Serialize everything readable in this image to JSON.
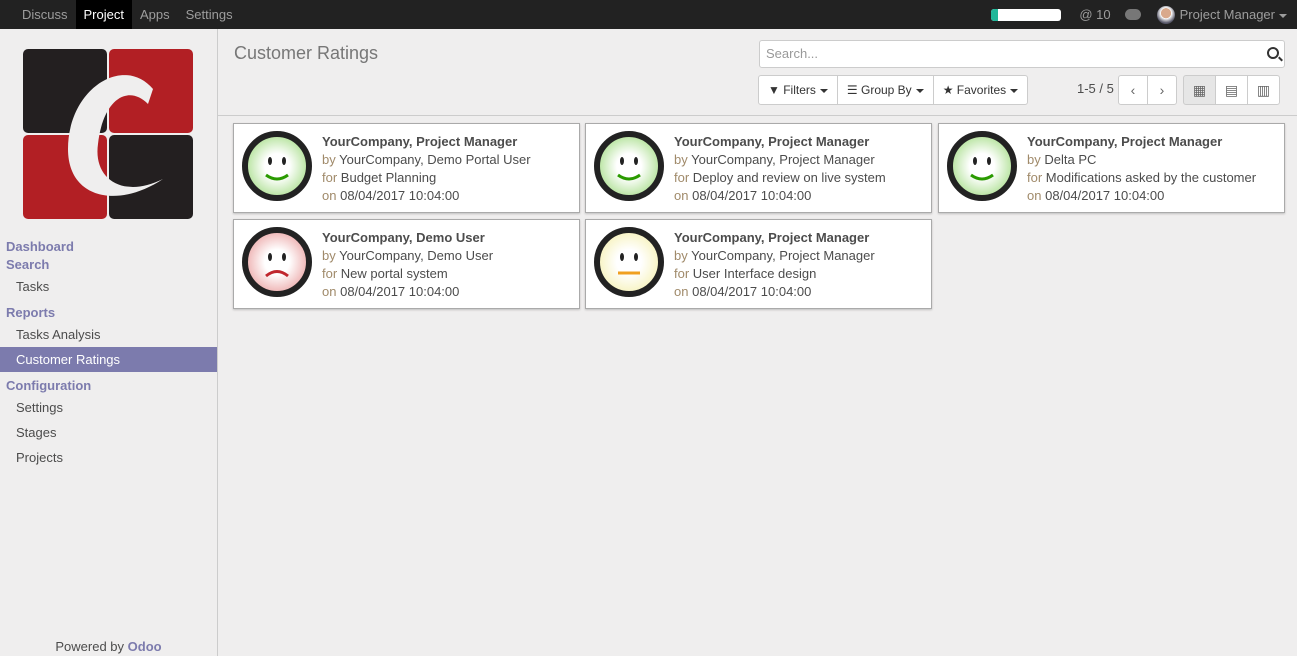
{
  "topbar": {
    "menu": [
      "Discuss",
      "Project",
      "Apps",
      "Settings"
    ],
    "active": "Project",
    "progress": 0.1,
    "mentions": "@ 10",
    "user": "Project Manager"
  },
  "sidebar": {
    "sections": [
      {
        "header": "Dashboard",
        "items": []
      },
      {
        "header": "Search",
        "items": [
          "Tasks"
        ]
      },
      {
        "header": "Reports",
        "items": [
          "Tasks Analysis",
          "Customer Ratings"
        ]
      },
      {
        "header": "Configuration",
        "items": [
          "Settings",
          "Stages",
          "Projects"
        ]
      }
    ],
    "active": "Customer Ratings",
    "powered_by": "Powered by",
    "odoo": "Odoo"
  },
  "control": {
    "title": "Customer Ratings",
    "search_placeholder": "Search...",
    "filters": "Filters",
    "group_by": "Group By",
    "favorites": "Favorites",
    "pager": "1-5 / 5"
  },
  "labels": {
    "by": "by",
    "for": "for",
    "on": "on"
  },
  "ratings": [
    {
      "rated": "YourCompany, Project Manager",
      "by": "YourCompany, Demo Portal User",
      "for": "Budget Planning",
      "on": "08/04/2017 10:04:00",
      "mood": "happy"
    },
    {
      "rated": "YourCompany, Project Manager",
      "by": "YourCompany, Project Manager",
      "for": "Deploy and review on live system",
      "on": "08/04/2017 10:04:00",
      "mood": "happy"
    },
    {
      "rated": "YourCompany, Project Manager",
      "by": "Delta PC",
      "for": "Modifications asked by the customer",
      "on": "08/04/2017 10:04:00",
      "mood": "happy"
    },
    {
      "rated": "YourCompany, Demo User",
      "by": "YourCompany, Demo User",
      "for": "New portal system",
      "on": "08/04/2017 10:04:00",
      "mood": "sad"
    },
    {
      "rated": "YourCompany, Project Manager",
      "by": "YourCompany, Project Manager",
      "for": "User Interface design",
      "on": "08/04/2017 10:04:00",
      "mood": "neutral"
    }
  ]
}
